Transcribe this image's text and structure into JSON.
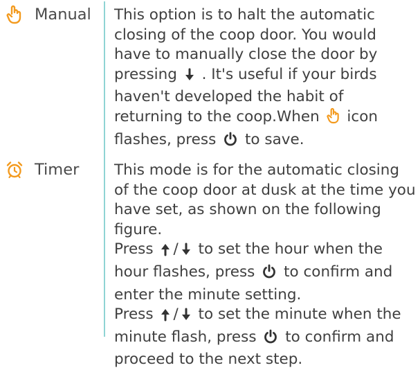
{
  "colors": {
    "accent_orange": "#f39a1e",
    "divider": "#8fd4d4",
    "text": "#3f3f3f"
  },
  "manual": {
    "label": "Manual",
    "icon": "hand-pointer-icon",
    "line1": "This option is to halt the automatic",
    "line2": "closing of the coop door. You would",
    "line3": "have to manually close the door by",
    "line4_before": "pressing",
    "line4_after": ". It's useful if your birds",
    "line5": "haven't developed the habit of",
    "line6_before": "returning to the coop.When",
    "line6_after": "icon",
    "line7_before": "flashes, press",
    "line7_after": "to save."
  },
  "timer": {
    "label": "Timer",
    "icon": "alarm-clock-icon",
    "line1": "This mode is for the automatic closing",
    "line2": "of the coop door at dusk at the time you",
    "line3": "have set, as shown on the following",
    "line4": "figure.",
    "line5_before": "Press",
    "line5_slash": "/",
    "line5_after": "to set the hour when the",
    "line6_before": "hour flashes, press",
    "line6_after": "to confirm and",
    "line7": "enter the minute setting.",
    "line8_before": "Press",
    "line8_slash": "/",
    "line8_after": "to set the minute when the",
    "line9_before": "minute flash, press",
    "line9_after": "to confirm and",
    "line10": "proceed to the next step."
  }
}
